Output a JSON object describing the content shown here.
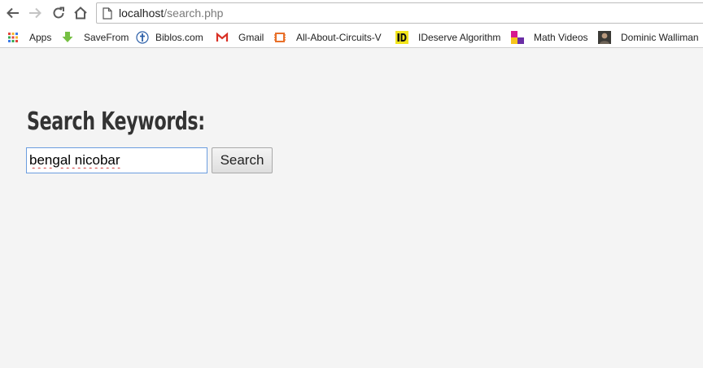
{
  "browser": {
    "address": {
      "host": "localhost",
      "path": "/search.php"
    },
    "bookmarks": [
      {
        "label": "Apps",
        "icon": "apps-grid-icon"
      },
      {
        "label": "SaveFrom",
        "icon": "download-arrow-icon"
      },
      {
        "label": "Biblos.com",
        "icon": "cross-icon"
      },
      {
        "label": "Gmail",
        "icon": "gmail-icon"
      },
      {
        "label": "All-About-Circuits-V",
        "icon": "chip-icon"
      },
      {
        "label": "IDeserve Algorithm",
        "icon": "id-logo-icon"
      },
      {
        "label": "Math Videos",
        "icon": "color-blocks-icon"
      },
      {
        "label": "Dominic Walliman",
        "icon": "avatar-icon"
      }
    ]
  },
  "page": {
    "heading": "Search Keywords:",
    "search": {
      "value": "bengal nicobar",
      "button_label": "Search"
    }
  },
  "colors": {
    "page_background": "#f4f4f4",
    "input_focus_border": "#6b9ddf",
    "heading": "#333333"
  }
}
